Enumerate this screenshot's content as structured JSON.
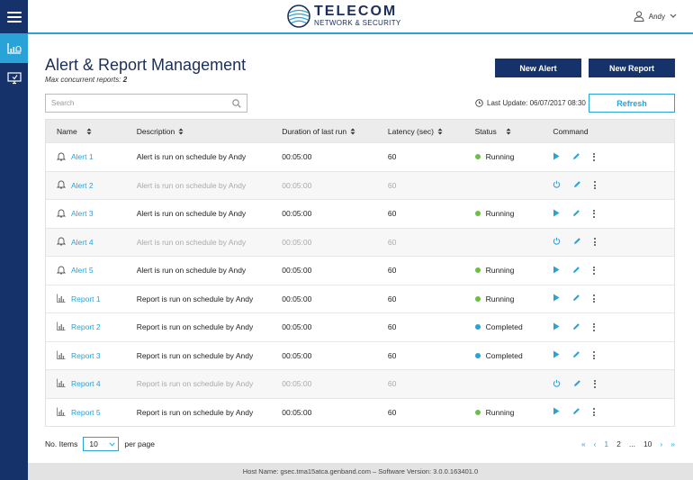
{
  "brand": {
    "line1": "TELECOM",
    "line2": "NETWORK & SECURITY"
  },
  "user": {
    "name": "Andy"
  },
  "page": {
    "title": "Alert & Report Management",
    "subtitle_label": "Max concurrent reports:",
    "subtitle_value": "2"
  },
  "actions": {
    "new_alert": "New Alert",
    "new_report": "New Report",
    "refresh": "Refresh"
  },
  "search": {
    "placeholder": "Search"
  },
  "last_update": "Last Update: 06/07/2017 08:30",
  "columns": [
    "Name",
    "Description",
    "Duration of last run",
    "Latency (sec)",
    "Status",
    "Command"
  ],
  "rows": [
    {
      "name": "Alert 1",
      "kind": "alert",
      "description": "Alert is run on schedule by Andy",
      "duration": "00:05:00",
      "latency": "60",
      "status": "Running",
      "enabled": true
    },
    {
      "name": "Alert 2",
      "kind": "alert",
      "description": "Alert is run on schedule by Andy",
      "duration": "00:05:00",
      "latency": "60",
      "status": "",
      "enabled": false
    },
    {
      "name": "Alert 3",
      "kind": "alert",
      "description": "Alert is run on schedule by Andy",
      "duration": "00:05:00",
      "latency": "60",
      "status": "Running",
      "enabled": true
    },
    {
      "name": "Alert 4",
      "kind": "alert",
      "description": "Alert is run on schedule by Andy",
      "duration": "00:05:00",
      "latency": "60",
      "status": "",
      "enabled": false
    },
    {
      "name": "Alert 5",
      "kind": "alert",
      "description": "Alert is run on schedule by Andy",
      "duration": "00:05:00",
      "latency": "60",
      "status": "Running",
      "enabled": true
    },
    {
      "name": "Report 1",
      "kind": "report",
      "description": "Report is run on schedule by Andy",
      "duration": "00:05:00",
      "latency": "60",
      "status": "Running",
      "enabled": true
    },
    {
      "name": "Report 2",
      "kind": "report",
      "description": "Report is run on schedule by Andy",
      "duration": "00:05:00",
      "latency": "60",
      "status": "Completed",
      "enabled": true
    },
    {
      "name": "Report 3",
      "kind": "report",
      "description": "Report is run on schedule by Andy",
      "duration": "00:05:00",
      "latency": "60",
      "status": "Completed",
      "enabled": true
    },
    {
      "name": "Report 4",
      "kind": "report",
      "description": "Report is run on schedule by Andy",
      "duration": "00:05:00",
      "latency": "60",
      "status": "",
      "enabled": false
    },
    {
      "name": "Report 5",
      "kind": "report",
      "description": "Report is run on schedule by Andy",
      "duration": "00:05:00",
      "latency": "60",
      "status": "Running",
      "enabled": true
    }
  ],
  "status_colors": {
    "Running": "#6abf45",
    "Completed": "#29a2d8"
  },
  "accent_color": "#29a2d8",
  "nav_color": "#15336a",
  "pagination": {
    "items_label": "No. Items",
    "items_value": "10",
    "per_page_label": "per page",
    "pages": [
      "1",
      "2",
      "...",
      "10"
    ],
    "current": "1"
  },
  "footer": "Host Name: gsec.tma15atca.genband.com  –  Software Version: 3.0.0.163401.0"
}
